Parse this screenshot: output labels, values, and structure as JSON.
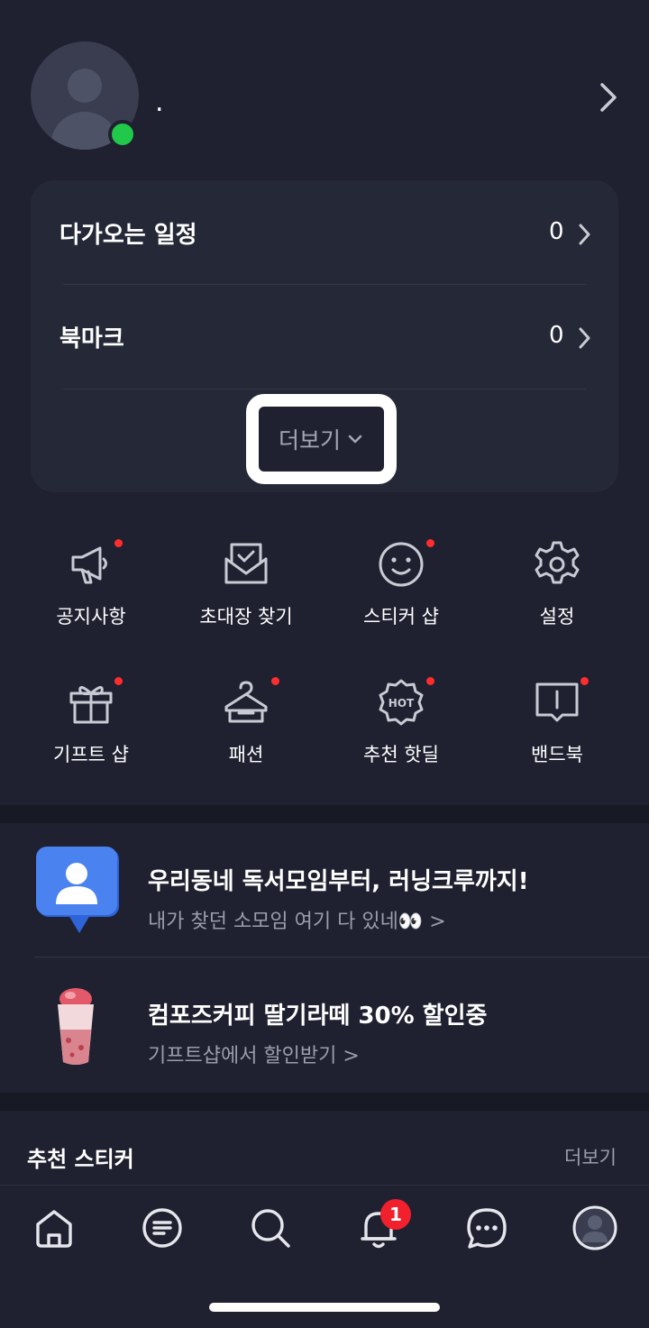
{
  "profile": {
    "name": ".",
    "online": true
  },
  "card": {
    "rows": [
      {
        "label": "다가오는 일정",
        "count": "0"
      },
      {
        "label": "북마크",
        "count": "0"
      }
    ],
    "more_label": "더보기"
  },
  "grid": [
    {
      "label": "공지사항",
      "icon": "megaphone-icon",
      "dot": true
    },
    {
      "label": "초대장 찾기",
      "icon": "invitation-icon",
      "dot": false
    },
    {
      "label": "스티커 샵",
      "icon": "smiley-icon",
      "dot": true
    },
    {
      "label": "설정",
      "icon": "gear-icon",
      "dot": false
    },
    {
      "label": "기프트 샵",
      "icon": "gift-icon",
      "dot": true
    },
    {
      "label": "패션",
      "icon": "hanger-icon",
      "dot": true
    },
    {
      "label": "추천 핫딜",
      "icon": "hot-badge-icon",
      "dot": true
    },
    {
      "label": "밴드북",
      "icon": "book-icon",
      "dot": true
    }
  ],
  "promos": [
    {
      "title": "우리동네 독서모임부터, 러닝크루까지!",
      "subtitle": "내가 찾던 소모임 여기 다 있네👀 >",
      "icon": "group-chat-icon"
    },
    {
      "title": "컴포즈커피 딸기라떼 30% 할인중",
      "subtitle": "기프트샵에서 할인받기 >",
      "icon": "strawberry-latte-image"
    }
  ],
  "recommended": {
    "title": "추천 스티커",
    "more": "더보기"
  },
  "nav": {
    "badge_count": "1",
    "items": [
      "home-icon",
      "feed-icon",
      "search-icon",
      "notification-icon",
      "chat-icon",
      "profile-icon"
    ]
  },
  "colors": {
    "background": "#1f2130",
    "card": "#252836",
    "accent_dot": "#ff2d2d",
    "online": "#20c94a",
    "badge": "#f0202c"
  }
}
